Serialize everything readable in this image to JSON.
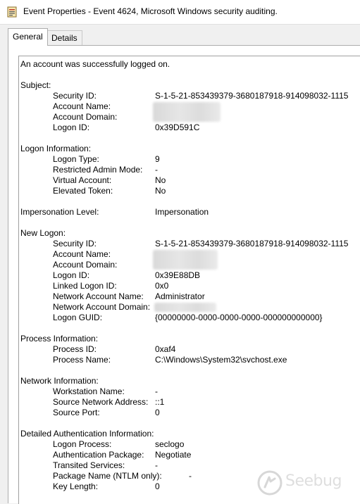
{
  "window": {
    "title": "Event Properties - Event 4624, Microsoft Windows security auditing."
  },
  "tabs": [
    {
      "label": "General"
    },
    {
      "label": "Details"
    }
  ],
  "event": {
    "message": "An account was successfully logged on.",
    "subject": {
      "heading": "Subject:",
      "security_id_label": "Security ID:",
      "security_id": "S-1-5-21-853439379-3680187918-914098032-1115",
      "account_name_label": "Account Name:",
      "account_domain_label": "Account Domain:",
      "logon_id_label": "Logon ID:",
      "logon_id": "0x39D591C"
    },
    "logon_info": {
      "heading": "Logon Information:",
      "logon_type_label": "Logon Type:",
      "logon_type": "9",
      "restricted_admin_label": "Restricted Admin Mode:",
      "restricted_admin": "-",
      "virtual_account_label": "Virtual Account:",
      "virtual_account": "No",
      "elevated_token_label": "Elevated Token:",
      "elevated_token": "No"
    },
    "impersonation": {
      "label": "Impersonation Level:",
      "value": "Impersonation"
    },
    "new_logon": {
      "heading": "New Logon:",
      "security_id_label": "Security ID:",
      "security_id": "S-1-5-21-853439379-3680187918-914098032-1115",
      "account_name_label": "Account Name:",
      "account_domain_label": "Account Domain:",
      "logon_id_label": "Logon ID:",
      "logon_id": "0x39E88DB",
      "linked_logon_id_label": "Linked Logon ID:",
      "linked_logon_id": "0x0",
      "network_account_name_label": "Network Account Name:",
      "network_account_name": "Administrator",
      "network_account_domain_label": "Network Account Domain:",
      "logon_guid_label": "Logon GUID:",
      "logon_guid": "{00000000-0000-0000-0000-000000000000}"
    },
    "process_info": {
      "heading": "Process Information:",
      "process_id_label": "Process ID:",
      "process_id": "0xaf4",
      "process_name_label": "Process Name:",
      "process_name": "C:\\Windows\\System32\\svchost.exe"
    },
    "network_info": {
      "heading": "Network Information:",
      "workstation_name_label": "Workstation Name:",
      "workstation_name": "-",
      "source_address_label": "Source Network Address:",
      "source_address": "::1",
      "source_port_label": "Source Port:",
      "source_port": "0"
    },
    "auth_info": {
      "heading": "Detailed Authentication Information:",
      "logon_process_label": "Logon Process:",
      "logon_process": "seclogo",
      "auth_package_label": "Authentication Package:",
      "auth_package": "Negotiate",
      "transited_services_label": "Transited Services:",
      "transited_services": "-",
      "package_name_label": "Package Name (NTLM only):",
      "package_name": "-",
      "key_length_label": "Key Length:",
      "key_length": "0"
    }
  },
  "watermark": {
    "text": "Seebug"
  }
}
